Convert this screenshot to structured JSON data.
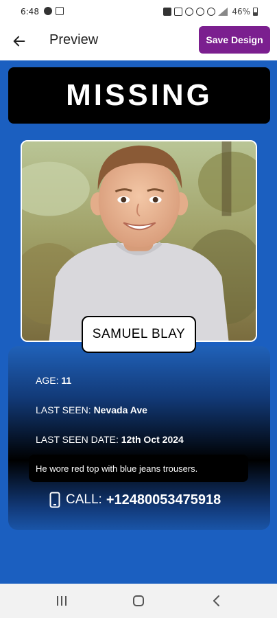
{
  "status_bar": {
    "time": "6:48",
    "battery": "46%",
    "icons": [
      "a-icon",
      "image-icon",
      "lock-icon",
      "n-icon",
      "bluetooth-icon",
      "headset-icon",
      "wifi-icon",
      "signal-icon",
      "battery-icon"
    ]
  },
  "app_bar": {
    "title": "Preview",
    "save_label": "Save Design",
    "back_icon": "arrow-left-icon",
    "save_color": "#7b1f8f"
  },
  "poster": {
    "headline": "MISSING",
    "name": "SAMUEL BLAY",
    "background": "#1b5fc0",
    "age_label": "AGE: ",
    "age_value": "11",
    "last_seen_label": "LAST SEEN: ",
    "last_seen_value": "Nevada Ave",
    "last_seen_date_label": "LAST SEEN DATE: ",
    "last_seen_date_value": "12th Oct 2024",
    "description": "He wore red top with blue jeans trousers.",
    "call_label": "CALL: ",
    "call_number": "+12480053475918",
    "call_icon": "phone-icon"
  },
  "nav_bar": {
    "icons": [
      "recent-apps-icon",
      "home-icon",
      "back-icon"
    ]
  }
}
